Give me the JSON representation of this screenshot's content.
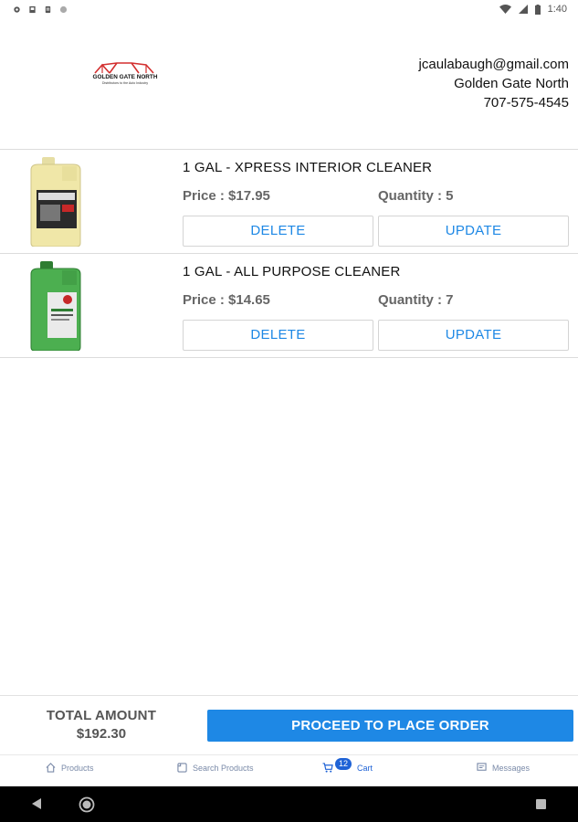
{
  "status_bar": {
    "time": "1:40",
    "left_icons": [
      "gear-icon",
      "sd-card-icon",
      "clipboard-icon",
      "dot-icon"
    ],
    "right_icons": [
      "wifi-icon",
      "signal-icon",
      "battery-icon"
    ]
  },
  "header": {
    "logo_text": "GOLDEN GATE NORTH",
    "logo_subtext": "Distributors to the Auto Industry",
    "email": "jcaulabaugh@gmail.com",
    "company": "Golden Gate North",
    "phone": "707-575-4545"
  },
  "cart_items": [
    {
      "name": "1 GAL - XPRESS INTERIOR CLEANER",
      "price": "Price : $17.95",
      "quantity": "Quantity : 5",
      "delete_label": "DELETE",
      "update_label": "UPDATE",
      "bottle_color": "#f0e7a8"
    },
    {
      "name": "1 GAL - ALL PURPOSE CLEANER",
      "price": "Price : $14.65",
      "quantity": "Quantity : 7",
      "delete_label": "DELETE",
      "update_label": "UPDATE",
      "bottle_color": "#4caf50"
    }
  ],
  "footer": {
    "total_label": "TOTAL AMOUNT",
    "total_amount": "$192.30",
    "proceed_label": "PROCEED TO PLACE ORDER"
  },
  "tabs": [
    {
      "label": "Products",
      "icon": "home-icon"
    },
    {
      "label": "Search Products",
      "icon": "search-products-icon"
    },
    {
      "label": "Cart",
      "icon": "cart-icon",
      "badge": "12",
      "active": true
    },
    {
      "label": "Messages",
      "icon": "messages-icon"
    }
  ],
  "colors": {
    "accent": "#1e88e5",
    "tab_active": "#1e62d6",
    "logo_red": "#d32f2f"
  }
}
